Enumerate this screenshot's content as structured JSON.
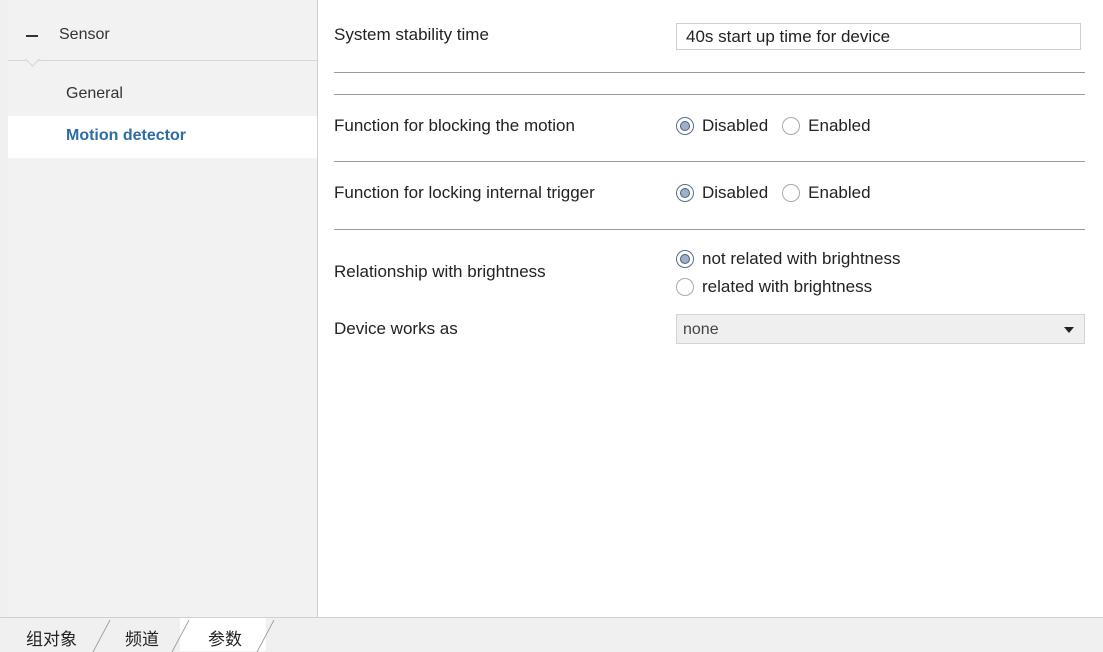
{
  "sidebar": {
    "section": {
      "label": "Sensor",
      "icon": "minus-icon"
    },
    "items": [
      {
        "label": "General",
        "selected": false
      },
      {
        "label": "Motion detector",
        "selected": true
      }
    ]
  },
  "main": {
    "stability": {
      "label": "System stability time",
      "value": "40s start up time for device"
    },
    "blocking": {
      "label": "Function for blocking the motion",
      "options": [
        "Disabled",
        "Enabled"
      ],
      "selected": "Disabled"
    },
    "locking": {
      "label": "Function for locking internal trigger",
      "options": [
        "Disabled",
        "Enabled"
      ],
      "selected": "Disabled"
    },
    "brightness": {
      "label": "Relationship with brightness",
      "options": [
        "not related with brightness",
        "related with brightness"
      ],
      "selected": "not related with brightness"
    },
    "device": {
      "label": "Device works as",
      "value": "none"
    }
  },
  "tabs": [
    {
      "label": "组对象",
      "active": false
    },
    {
      "label": "频道",
      "active": false
    },
    {
      "label": "参数",
      "active": true
    }
  ],
  "colors": {
    "accent": "#2d6da3",
    "radio_fill": "#9bb0c9"
  }
}
